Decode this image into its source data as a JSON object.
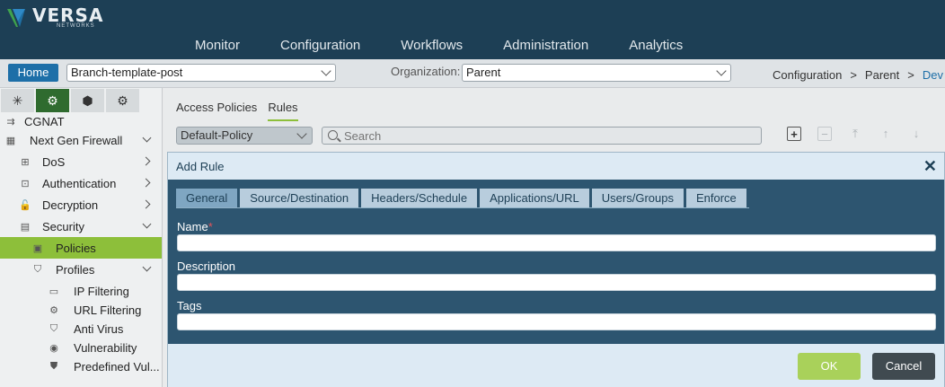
{
  "brand": {
    "name": "VERSA",
    "sub": "NETWORKS"
  },
  "nav": [
    "Monitor",
    "Configuration",
    "Workflows",
    "Administration",
    "Analytics"
  ],
  "subbar": {
    "home_label": "Home",
    "template_value": "Branch-template-post",
    "org_label": "Organization:",
    "org_value": "Parent",
    "breadcrumb": [
      "Configuration",
      "Parent",
      "Dev"
    ]
  },
  "sidebar": {
    "tabs": [
      "network-icon",
      "gear-icon",
      "cube-icon",
      "settings-gear-icon"
    ],
    "items": [
      {
        "label": "CGNAT",
        "icon": "cgnat-icon"
      },
      {
        "label": "Next Gen Firewall",
        "icon": "firewall-icon"
      },
      {
        "label": "DoS",
        "icon": "dos-icon"
      },
      {
        "label": "Authentication",
        "icon": "authentication-icon"
      },
      {
        "label": "Decryption",
        "icon": "lock-icon"
      },
      {
        "label": "Security",
        "icon": "security-icon"
      },
      {
        "label": "Policies",
        "icon": "policies-icon"
      },
      {
        "label": "Profiles",
        "icon": "shield-icon"
      },
      {
        "label": "IP Filtering",
        "icon": "ip-filter-icon"
      },
      {
        "label": "URL Filtering",
        "icon": "url-filter-icon"
      },
      {
        "label": "Anti Virus",
        "icon": "antivirus-icon"
      },
      {
        "label": "Vulnerability",
        "icon": "vulnerability-icon"
      },
      {
        "label": "Predefined Vul...",
        "icon": "shield-icon"
      }
    ]
  },
  "content": {
    "tabs": [
      "Access Policies",
      "Rules"
    ],
    "active_tab": "Rules",
    "policy_value": "Default-Policy",
    "search_placeholder": "Search"
  },
  "modal": {
    "title": "Add Rule",
    "close": "✕",
    "tabs": [
      "General",
      "Source/Destination",
      "Headers/Schedule",
      "Applications/URL",
      "Users/Groups",
      "Enforce"
    ],
    "active_tab": "General",
    "fields": {
      "name_label": "Name",
      "name_required": "*",
      "name_value": "",
      "description_label": "Description",
      "description_value": "",
      "tags_label": "Tags",
      "tags_value": ""
    },
    "ok_label": "OK",
    "cancel_label": "Cancel"
  },
  "colors": {
    "header_bg": "#1d3f55",
    "accent_green": "#8dbf3a",
    "modal_body": "#2d5570",
    "ok_green": "#a9d15a",
    "cancel_dark": "#404a50"
  }
}
